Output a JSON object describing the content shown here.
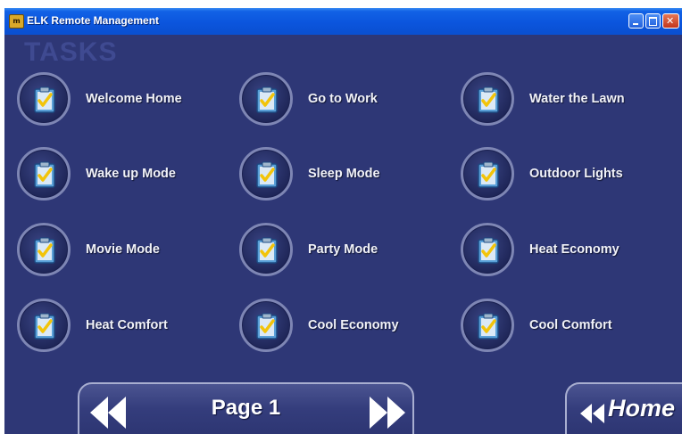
{
  "window": {
    "title": "ELK Remote Management",
    "app_icon_text": "m"
  },
  "section_title": "TASKS",
  "tasks": [
    {
      "label": "Welcome Home"
    },
    {
      "label": "Go to Work"
    },
    {
      "label": "Water the Lawn"
    },
    {
      "label": "Wake up Mode"
    },
    {
      "label": "Sleep Mode"
    },
    {
      "label": "Outdoor Lights"
    },
    {
      "label": "Movie Mode"
    },
    {
      "label": "Party Mode"
    },
    {
      "label": "Heat Economy"
    },
    {
      "label": "Heat Comfort"
    },
    {
      "label": "Cool Economy"
    },
    {
      "label": "Cool Comfort"
    }
  ],
  "task_icon": "clipboard-checkmark-icon",
  "pager": {
    "label": "Page 1",
    "prev_icon": "double-left-arrow-icon",
    "next_icon": "double-right-arrow-icon"
  },
  "home_button": {
    "label": "Home",
    "icon": "double-left-arrow-icon"
  },
  "colors": {
    "background": "#2e3776",
    "titlebar": "#0b55dd",
    "text": "#f1f2f8",
    "check": "#f2c40a"
  }
}
